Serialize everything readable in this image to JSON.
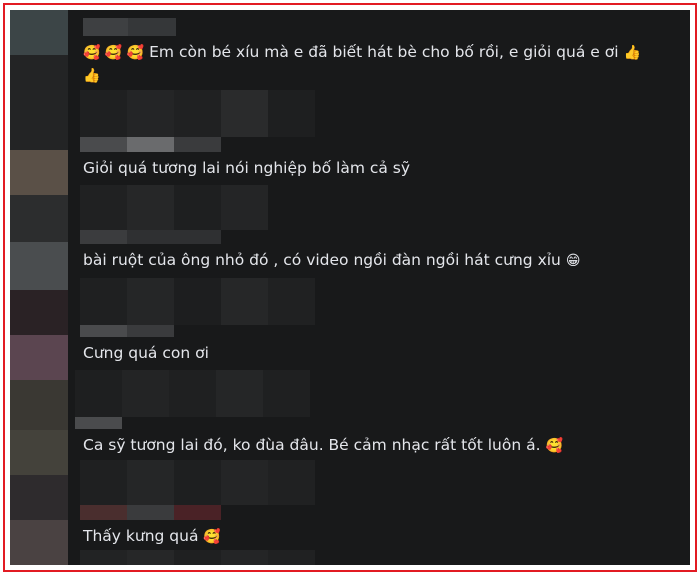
{
  "colors": {
    "frame_border": "#e21b23",
    "panel_bg": "#18191a",
    "text": "#e4e6eb"
  },
  "comments": [
    {
      "prefix": "🥰 🥰 🥰",
      "text": "Em còn bé xíu mà e đã biết hát bè cho bố rồi, e giỏi quá e ơi",
      "suffix": "👍",
      "line2": "👍"
    },
    {
      "text": "Giỏi quá tương lai nói nghiệp bố làm cả sỹ"
    },
    {
      "text": "bài ruột của ông nhỏ đó , có video ngồi đàn ngồi hát cưng xỉu",
      "suffix": "😁"
    },
    {
      "text": "Cưng quá con ơi"
    },
    {
      "text": "Ca sỹ tương lai đó, ko đùa đâu. Bé cảm nhạc rất tốt luôn á.",
      "suffix": "🥰"
    },
    {
      "text": "Thấy kưng quá",
      "suffix": "🥰"
    }
  ]
}
